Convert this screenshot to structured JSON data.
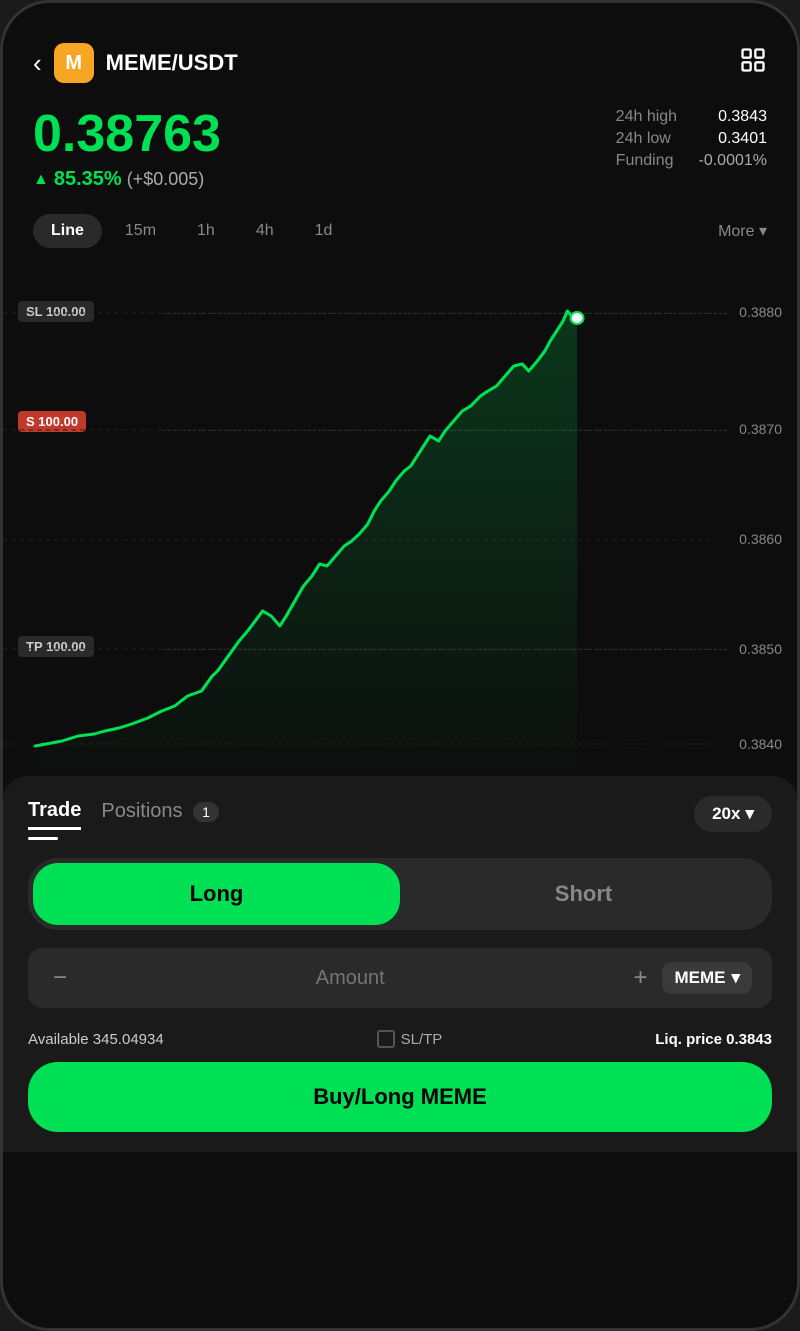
{
  "header": {
    "back_label": "‹",
    "coin_icon_label": "M",
    "pair_name": "MEME/USDT",
    "settings_icon": "⛕"
  },
  "price": {
    "current": "0.38763",
    "change_pct": "85.35%",
    "change_abs": "(+$0.005)",
    "high_label": "24h high",
    "high_value": "0.3843",
    "low_label": "24h low",
    "low_value": "0.3401",
    "funding_label": "Funding",
    "funding_value": "-0.0001%"
  },
  "chart_tabs": {
    "tabs": [
      "Line",
      "15m",
      "1h",
      "4h",
      "1d"
    ],
    "active": "Line",
    "more_label": "More ▾"
  },
  "chart": {
    "labels": {
      "sl": "SL 100.00",
      "s": "S 100.00",
      "tp": "TP 100.00"
    },
    "price_levels": [
      "0.3880",
      "0.3870",
      "0.3860",
      "0.3850",
      "0.3840"
    ]
  },
  "trade_panel": {
    "tab_trade": "Trade",
    "tab_positions": "Positions",
    "positions_count": "1",
    "leverage": "20x",
    "long_label": "Long",
    "short_label": "Short",
    "amount_placeholder": "Amount",
    "minus_label": "−",
    "plus_label": "+",
    "coin_label": "MEME",
    "available_label": "Available",
    "available_value": "345.04934",
    "sltp_label": "SL/TP",
    "liq_label": "Liq. price",
    "liq_value": "0.3843",
    "buy_button_label": "Buy/Long MEME"
  },
  "colors": {
    "green": "#00e054",
    "red": "#c0392b",
    "bg": "#0d0d0d",
    "panel": "#1a1a1a"
  }
}
